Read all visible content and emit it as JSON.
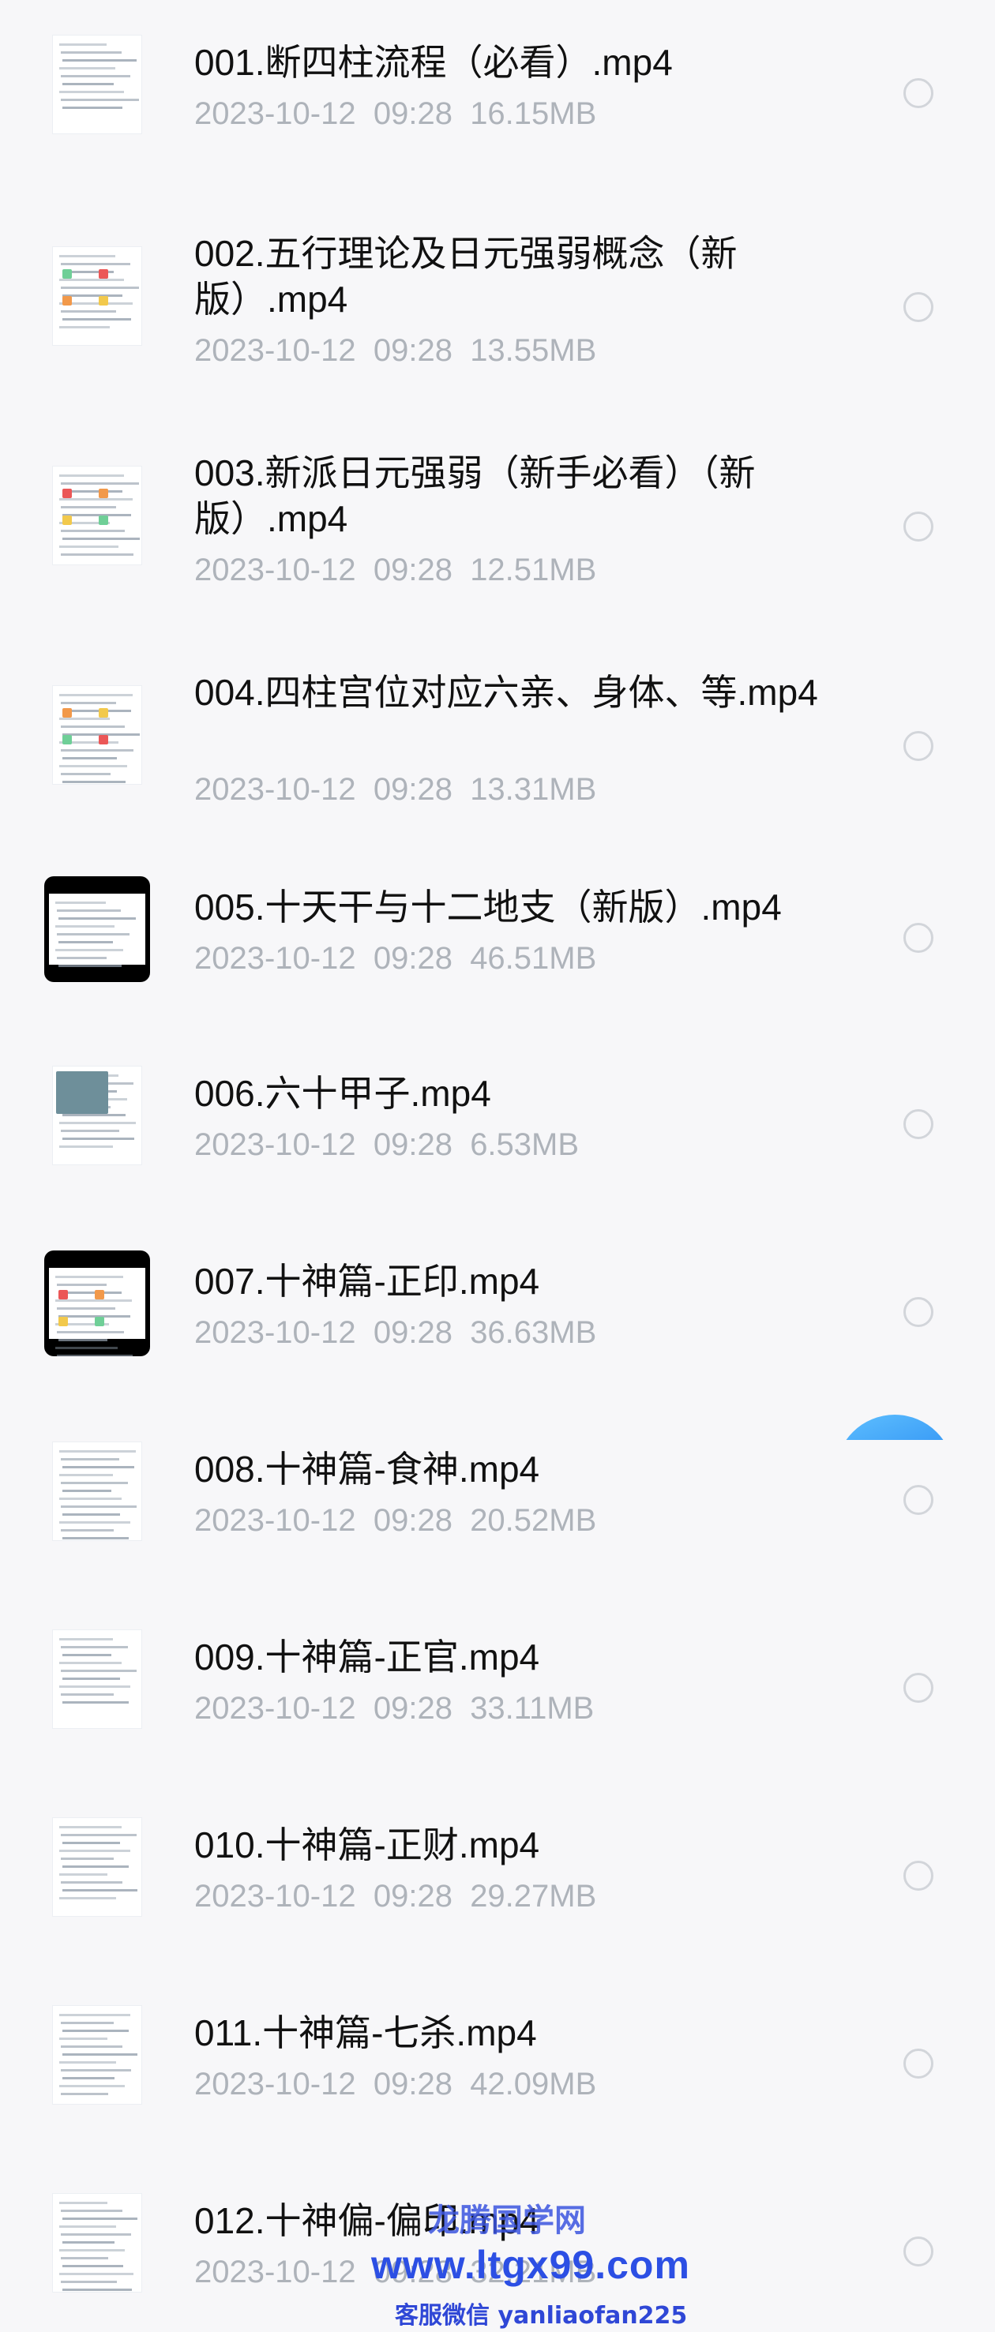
{
  "files": [
    {
      "name": "001.断四柱流程（必看）.mp4",
      "date": "2023-10-12",
      "time": "09:28",
      "size": "16.15MB",
      "thumb_icon": "document-thumbnail-icon"
    },
    {
      "name": "002.五行理论及日元强弱概念（新版）.mp4",
      "date": "2023-10-12",
      "time": "09:28",
      "size": "13.55MB",
      "thumb_icon": "document-thumbnail-icon"
    },
    {
      "name": "003.新派日元强弱（新手必看）（新版）.mp4",
      "date": "2023-10-12",
      "time": "09:28",
      "size": "12.51MB",
      "thumb_icon": "document-thumbnail-icon"
    },
    {
      "name": "004.四柱宫位对应六亲、身体、等.mp4",
      "date": "2023-10-12",
      "time": "09:28",
      "size": "13.31MB",
      "thumb_icon": "document-thumbnail-icon"
    },
    {
      "name": "005.十天干与十二地支（新版）.mp4",
      "date": "2023-10-12",
      "time": "09:28",
      "size": "46.51MB",
      "thumb_icon": "video-thumbnail-icon"
    },
    {
      "name": "006.六十甲子.mp4",
      "date": "2023-10-12",
      "time": "09:28",
      "size": "6.53MB",
      "thumb_icon": "document-thumbnail-icon"
    },
    {
      "name": "007.十神篇-正印.mp4",
      "date": "2023-10-12",
      "time": "09:28",
      "size": "36.63MB",
      "thumb_icon": "video-thumbnail-icon"
    },
    {
      "name": "008.十神篇-食神.mp4",
      "date": "2023-10-12",
      "time": "09:28",
      "size": "20.52MB",
      "thumb_icon": "document-thumbnail-icon"
    },
    {
      "name": "009.十神篇-正官.mp4",
      "date": "2023-10-12",
      "time": "09:28",
      "size": "33.11MB",
      "thumb_icon": "document-thumbnail-icon"
    },
    {
      "name": "010.十神篇-正财.mp4",
      "date": "2023-10-12",
      "time": "09:28",
      "size": "29.27MB",
      "thumb_icon": "document-thumbnail-icon"
    },
    {
      "name": "011.十神篇-七杀.mp4",
      "date": "2023-10-12",
      "time": "09:28",
      "size": "42.09MB",
      "thumb_icon": "document-thumbnail-icon"
    },
    {
      "name": "012.十神偏-偏印.mp4",
      "date": "2023-10-12",
      "time": "09:28",
      "size": "32.21MB",
      "thumb_icon": "document-thumbnail-icon"
    }
  ],
  "watermark": {
    "line1": "龙腾国学网",
    "line2": "www.ltgx99.com",
    "line3": "客服微信 yanliaofan225"
  },
  "colors": {
    "title": "#111111",
    "meta": "#aeb3ba",
    "radio_border": "#d2d5da",
    "fab": "#2a8cf2",
    "background": "#f7f7f9"
  }
}
